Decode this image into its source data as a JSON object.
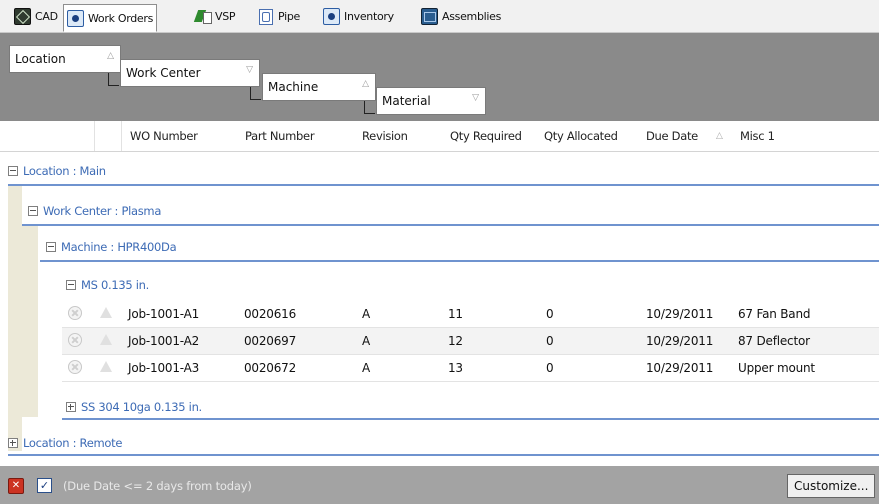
{
  "tabs": [
    {
      "label": "CAD",
      "icon": "cad-icon",
      "active": false
    },
    {
      "label": "Work Orders",
      "icon": "work-orders-icon",
      "active": true
    },
    {
      "label": "VSP",
      "icon": "vsp-icon",
      "active": false
    },
    {
      "label": "Pipe",
      "icon": "pipe-icon",
      "active": false
    },
    {
      "label": "Inventory",
      "icon": "inventory-icon",
      "active": false
    },
    {
      "label": "Assemblies",
      "icon": "assemblies-icon",
      "active": false
    }
  ],
  "grouping": {
    "chips": [
      "Location",
      "Work Center",
      "Machine",
      "Material"
    ]
  },
  "columns": [
    "WO Number",
    "Part Number",
    "Revision",
    "Qty Required",
    "Qty Allocated",
    "Due Date",
    "Misc 1"
  ],
  "groups": {
    "location_main": "Location : Main",
    "work_center": "Work Center : Plasma",
    "machine": "Machine : HPR400Da",
    "material_ms": "MS 0.135 in.",
    "material_ss": "SS 304 10ga 0.135 in.",
    "location_remote": "Location : Remote"
  },
  "rows": [
    {
      "wo": "Job-1001-A1",
      "part": "0020616",
      "rev": "A",
      "qty_req": "11",
      "qty_alloc": "0",
      "due": "10/29/2011",
      "misc": "67 Fan Band"
    },
    {
      "wo": "Job-1001-A2",
      "part": "0020697",
      "rev": "A",
      "qty_req": "12",
      "qty_alloc": "0",
      "due": "10/29/2011",
      "misc": "87 Deflector"
    },
    {
      "wo": "Job-1001-A3",
      "part": "0020672",
      "rev": "A",
      "qty_req": "13",
      "qty_alloc": "0",
      "due": "10/29/2011",
      "misc": "Upper mount"
    }
  ],
  "footer": {
    "filter_text": "(Due Date <= 2 days from today)",
    "customize_label": "Customize...",
    "filter_checked": true
  },
  "colors": {
    "group_text": "#3d6bb5",
    "group_line": "#6f93cf",
    "panel_gray": "#8a8a8a",
    "footer_gray": "#a3a3a3"
  }
}
